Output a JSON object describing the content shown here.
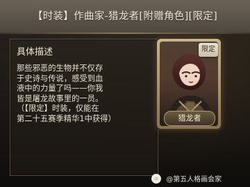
{
  "header": {
    "title": "【时装】作曲家-猎龙者[附赠角色][限定]"
  },
  "description": {
    "heading": "具体描述",
    "body": "那些邪恶的生物并不仅存\n于史诗与传说，感受到血\n液中的力量了吗——你我\n皆是屠龙故事里的一员。\n（【限定】时装，仅能在\n第二十五赛季精华1中获得）"
  },
  "card": {
    "badge": "限定",
    "name": "猎龙者"
  },
  "watermark": {
    "text": "@第五人格画会家"
  },
  "colors": {
    "title_bar": "#5b5449",
    "text": "#e9e2d4",
    "card_frame": "#c9b68c"
  }
}
